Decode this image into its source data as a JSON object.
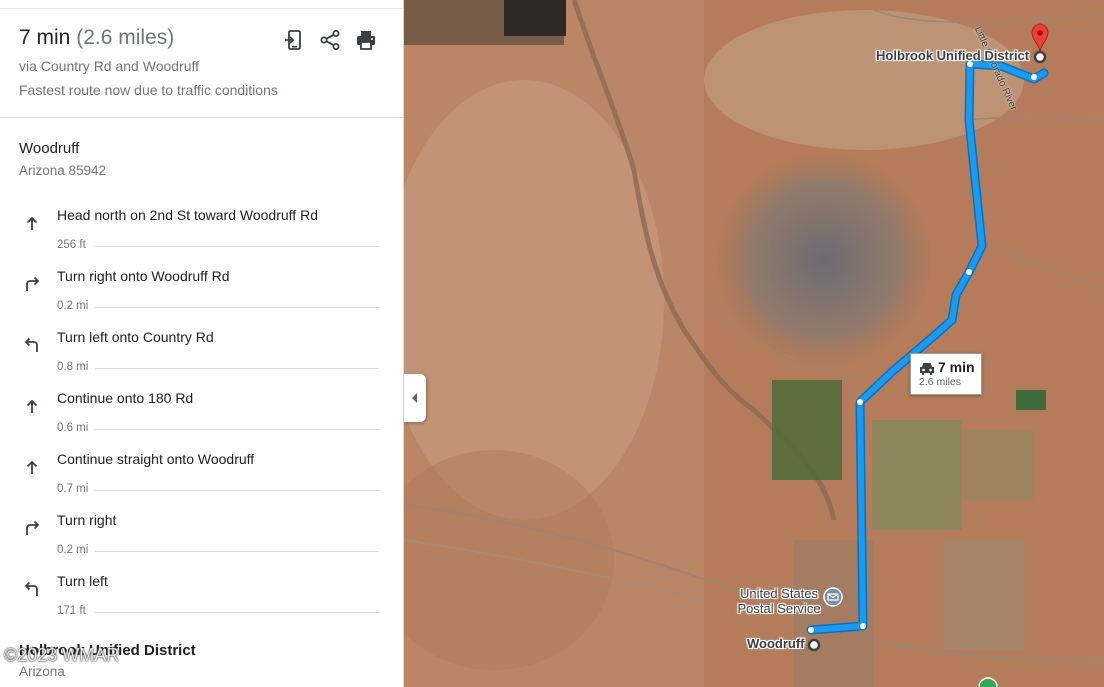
{
  "summary": {
    "time": "7 min",
    "distance": "(2.6 miles)",
    "via": "via Country Rd and Woodruff",
    "note": "Fastest route now due to traffic conditions"
  },
  "actions": {
    "send_icon": "send-to-phone-icon",
    "share_icon": "share-icon",
    "print_icon": "print-icon"
  },
  "origin": {
    "name": "Woodruff",
    "sub": "Arizona 85942"
  },
  "steps": [
    {
      "icon": "arrow-up",
      "text": "Head north on 2nd St toward Woodruff Rd",
      "dist": "256 ft"
    },
    {
      "icon": "turn-right",
      "text": "Turn right onto Woodruff Rd",
      "dist": "0.2 mi"
    },
    {
      "icon": "turn-left",
      "text": "Turn left onto Country Rd",
      "dist": "0.8 mi"
    },
    {
      "icon": "arrow-up",
      "text": "Continue onto 180 Rd",
      "dist": "0.6 mi"
    },
    {
      "icon": "arrow-up",
      "text": "Continue straight onto Woodruff",
      "dist": "0.7 mi"
    },
    {
      "icon": "turn-right",
      "text": "Turn right",
      "dist": "0.2 mi"
    },
    {
      "icon": "turn-left",
      "text": "Turn left",
      "dist": "171 ft"
    }
  ],
  "destination": {
    "name": "Holbrook Unified District",
    "sub": "Arizona"
  },
  "watermark": "©2023 WMAR",
  "map": {
    "route_badge_time": "7 min",
    "route_badge_distance": "2.6 miles",
    "label_destination": "Holbrook Unified District",
    "label_origin": "Woodruff",
    "label_poi": "United States Postal Service",
    "label_river": "Little Colorado River",
    "route_color": "#1a9bf0",
    "pin_color": "#ea4335"
  }
}
